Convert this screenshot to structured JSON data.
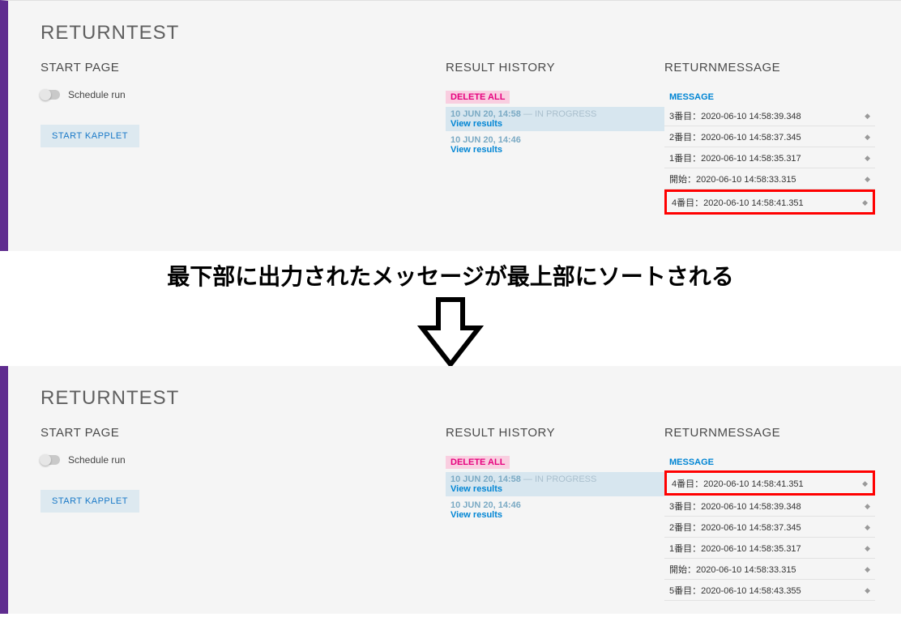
{
  "annotation": "最下部に出力されたメッセージが最上部にソートされる",
  "top": {
    "title": "RETURNTEST",
    "start": {
      "header": "START PAGE",
      "toggle_label": "Schedule run",
      "button": "START KAPPLET"
    },
    "history": {
      "header": "RESULT HISTORY",
      "delete": "DELETE ALL",
      "items": [
        {
          "time": "10 JUN 20, 14:58",
          "status": " — IN PROGRESS",
          "view": "View results",
          "selected": true
        },
        {
          "time": "10 JUN 20, 14:46",
          "status": "",
          "view": "View results",
          "selected": false
        }
      ]
    },
    "messages": {
      "header": "RETURNMESSAGE",
      "col": "MESSAGE",
      "rows": [
        {
          "text": "3番目：2020-06-10 14:58:39.348",
          "hl": false
        },
        {
          "text": "2番目：2020-06-10 14:58:37.345",
          "hl": false
        },
        {
          "text": "1番目：2020-06-10 14:58:35.317",
          "hl": false
        },
        {
          "text": "開始：2020-06-10 14:58:33.315",
          "hl": false
        },
        {
          "text": "4番目：2020-06-10 14:58:41.351",
          "hl": true
        }
      ]
    }
  },
  "bottom": {
    "title": "RETURNTEST",
    "start": {
      "header": "START PAGE",
      "toggle_label": "Schedule run",
      "button": "START KAPPLET"
    },
    "history": {
      "header": "RESULT HISTORY",
      "delete": "DELETE ALL",
      "items": [
        {
          "time": "10 JUN 20, 14:58",
          "status": " — IN PROGRESS",
          "view": "View results",
          "selected": true
        },
        {
          "time": "10 JUN 20, 14:46",
          "status": "",
          "view": "View results",
          "selected": false
        }
      ]
    },
    "messages": {
      "header": "RETURNMESSAGE",
      "col": "MESSAGE",
      "rows": [
        {
          "text": "4番目：2020-06-10 14:58:41.351",
          "hl": true
        },
        {
          "text": "3番目：2020-06-10 14:58:39.348",
          "hl": false
        },
        {
          "text": "2番目：2020-06-10 14:58:37.345",
          "hl": false
        },
        {
          "text": "1番目：2020-06-10 14:58:35.317",
          "hl": false
        },
        {
          "text": "開始：2020-06-10 14:58:33.315",
          "hl": false
        },
        {
          "text": "5番目：2020-06-10 14:58:43.355",
          "hl": false
        }
      ]
    }
  }
}
